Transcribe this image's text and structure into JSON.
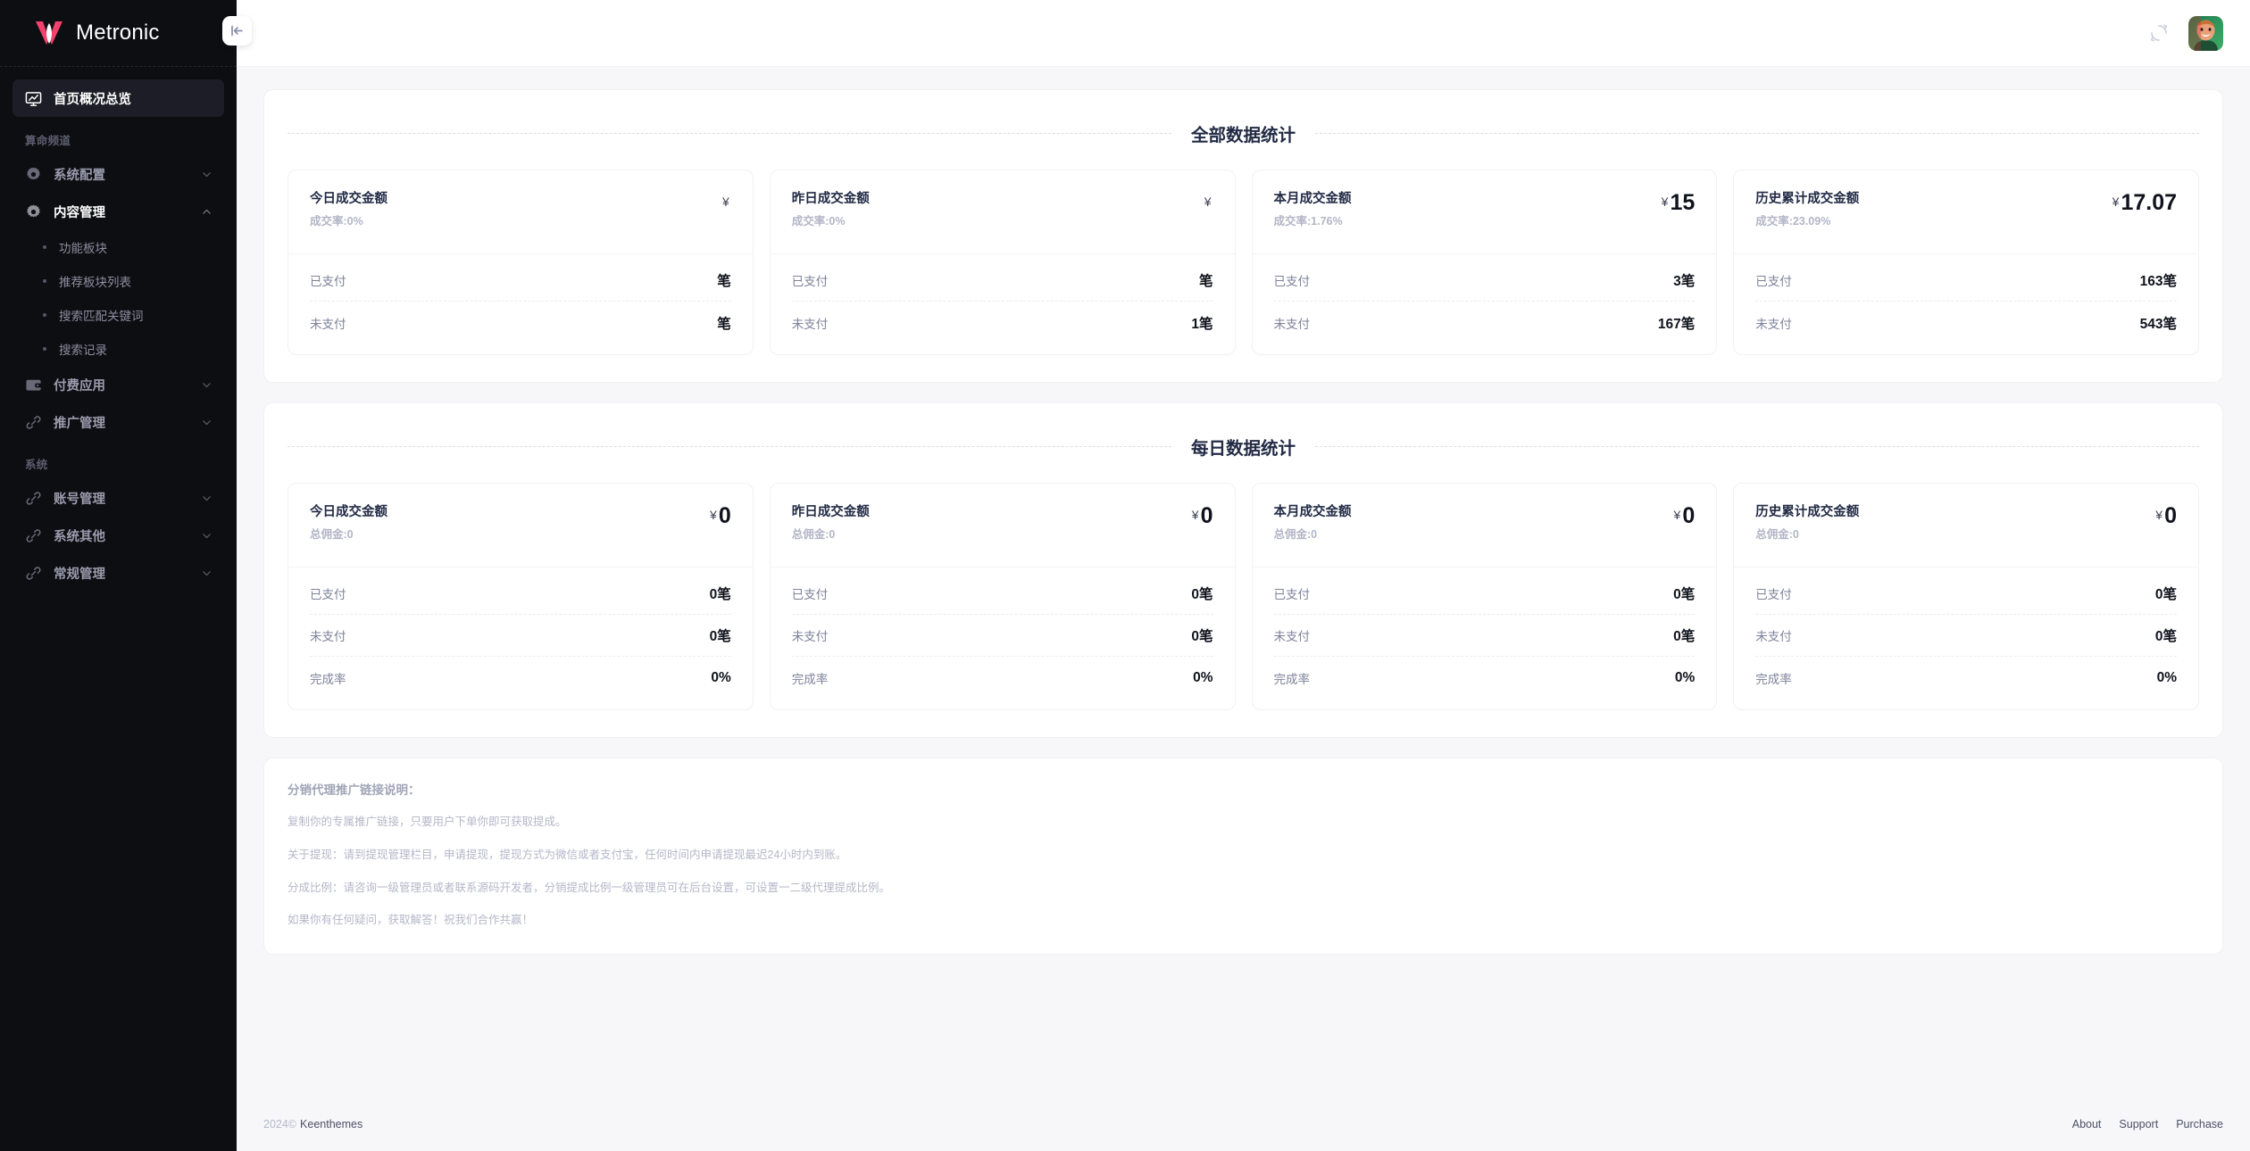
{
  "brand": {
    "name": "Metronic",
    "logo_icon": "metronic-logo-icon"
  },
  "sidebar": {
    "home": {
      "label": "首页概况总览",
      "icon": "dashboard-icon"
    },
    "section_channel": "算命频道",
    "section_system": "系统",
    "groups": [
      {
        "label": "系统配置",
        "icon": "gear-icon",
        "chevron": "chevron-down-icon",
        "expanded": false
      },
      {
        "label": "内容管理",
        "icon": "gear-icon",
        "chevron": "chevron-up-icon",
        "expanded": true
      }
    ],
    "sub_items": [
      {
        "label": "功能板块"
      },
      {
        "label": "推荐板块列表"
      },
      {
        "label": "搜索匹配关键词"
      },
      {
        "label": "搜索记录"
      }
    ],
    "groups2": [
      {
        "label": "付费应用",
        "icon": "wallet-icon",
        "chevron": "chevron-down-icon"
      },
      {
        "label": "推广管理",
        "icon": "link-icon",
        "chevron": "chevron-down-icon"
      }
    ],
    "system_items": [
      {
        "label": "账号管理",
        "icon": "link-icon",
        "chevron": "chevron-down-icon"
      },
      {
        "label": "系统其他",
        "icon": "link-icon",
        "chevron": "chevron-down-icon"
      },
      {
        "label": "常规管理",
        "icon": "link-icon",
        "chevron": "chevron-down-icon"
      }
    ]
  },
  "topbar": {
    "collapse_icon": "collapse-sidebar-icon",
    "loading_icon": "loading-spinner-icon",
    "avatar_icon": "user-avatar"
  },
  "sections": [
    {
      "title": "全部数据统计",
      "cards": [
        {
          "name": "今日成交金额",
          "sub": "成交率:0%",
          "currency": "¥",
          "amount": "",
          "rows": [
            {
              "k": "已支付",
              "v": "笔"
            },
            {
              "k": "未支付",
              "v": "笔"
            }
          ]
        },
        {
          "name": "昨日成交金额",
          "sub": "成交率:0%",
          "currency": "¥",
          "amount": "",
          "rows": [
            {
              "k": "已支付",
              "v": "笔"
            },
            {
              "k": "未支付",
              "v": "1笔"
            }
          ]
        },
        {
          "name": "本月成交金额",
          "sub": "成交率:1.76%",
          "currency": "¥",
          "amount": "15",
          "rows": [
            {
              "k": "已支付",
              "v": "3笔"
            },
            {
              "k": "未支付",
              "v": "167笔"
            }
          ]
        },
        {
          "name": "历史累计成交金额",
          "sub": "成交率:23.09%",
          "currency": "¥",
          "amount": "17.07",
          "rows": [
            {
              "k": "已支付",
              "v": "163笔"
            },
            {
              "k": "未支付",
              "v": "543笔"
            }
          ]
        }
      ]
    },
    {
      "title": "每日数据统计",
      "cards": [
        {
          "name": "今日成交金额",
          "sub": "总佣金:0",
          "currency": "¥",
          "amount": "0",
          "rows": [
            {
              "k": "已支付",
              "v": "0笔"
            },
            {
              "k": "未支付",
              "v": "0笔"
            },
            {
              "k": "完成率",
              "v": "0%"
            }
          ]
        },
        {
          "name": "昨日成交金额",
          "sub": "总佣金:0",
          "currency": "¥",
          "amount": "0",
          "rows": [
            {
              "k": "已支付",
              "v": "0笔"
            },
            {
              "k": "未支付",
              "v": "0笔"
            },
            {
              "k": "完成率",
              "v": "0%"
            }
          ]
        },
        {
          "name": "本月成交金额",
          "sub": "总佣金:0",
          "currency": "¥",
          "amount": "0",
          "rows": [
            {
              "k": "已支付",
              "v": "0笔"
            },
            {
              "k": "未支付",
              "v": "0笔"
            },
            {
              "k": "完成率",
              "v": "0%"
            }
          ]
        },
        {
          "name": "历史累计成交金额",
          "sub": "总佣金:0",
          "currency": "¥",
          "amount": "0",
          "rows": [
            {
              "k": "已支付",
              "v": "0笔"
            },
            {
              "k": "未支付",
              "v": "0笔"
            },
            {
              "k": "完成率",
              "v": "0%"
            }
          ]
        }
      ]
    }
  ],
  "notes": {
    "title": "分销代理推广链接说明：",
    "lines": [
      "复制你的专属推广链接，只要用户下单你即可获取提成。",
      "关于提现：请到提现管理栏目，申请提现，提现方式为微信或者支付宝，任何时间内申请提现最迟24小时内到账。",
      "分成比例：请咨询一级管理员或者联系源码开发者，分销提成比例一级管理员可在后台设置，可设置一二级代理提成比例。",
      "如果你有任何疑问，获取解答！祝我们合作共赢！"
    ]
  },
  "footer": {
    "year": "2024©",
    "company": "Keenthemes",
    "links": [
      "About",
      "Support",
      "Purchase"
    ]
  },
  "colors": {
    "sidebar_bg": "#0d0e12",
    "content_bg": "#f7f7f9",
    "brand_red": "#f1416c",
    "heading": "#222b45",
    "muted": "#b5b7c8"
  }
}
